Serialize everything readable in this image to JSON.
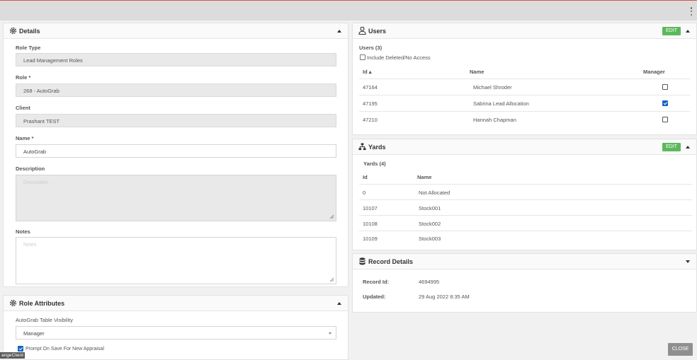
{
  "details": {
    "title": "Details",
    "role_type_label": "Role Type",
    "role_type_value": "Lead Management Roles",
    "role_label": "Role *",
    "role_value": "268 - AutoGrab",
    "client_label": "Client",
    "client_value": "Prashant TEST",
    "name_label": "Name *",
    "name_value": "AutoGrab",
    "description_label": "Description",
    "description_placeholder": "Description",
    "notes_label": "Notes",
    "notes_placeholder": "Notes"
  },
  "role_attributes": {
    "title": "Role Attributes",
    "visibility_label": "AutoGrab Table Visibility",
    "visibility_value": "Manager",
    "prompt_label": "Prompt On Save For New Appraisal",
    "prompt_checked": true
  },
  "users": {
    "title": "Users",
    "edit_label": "EDIT",
    "count_label": "Users (3)",
    "include_deleted_label": "Include Deleted/No Access",
    "col_id": "Id ▴",
    "col_name": "Name",
    "col_manager": "Manager",
    "rows": [
      {
        "id": "47164",
        "name": "Michael Shroder",
        "manager": false
      },
      {
        "id": "47195",
        "name": "Sabrina Lead Allocation",
        "manager": true
      },
      {
        "id": "47210",
        "name": "Hannah Chapman",
        "manager": false
      }
    ]
  },
  "yards": {
    "title": "Yards",
    "edit_label": "EDIT",
    "count_label": "Yards (4)",
    "col_id": "Id",
    "col_name": "Name",
    "rows": [
      {
        "id": "0",
        "name": "Not Allocated"
      },
      {
        "id": "10107",
        "name": "Stock001"
      },
      {
        "id": "10108",
        "name": "Stock002"
      },
      {
        "id": "10109",
        "name": "Stock003"
      }
    ]
  },
  "record": {
    "title": "Record Details",
    "record_id_label": "Record Id:",
    "record_id_value": "4694995",
    "updated_label": "Updated:",
    "updated_value": "29 Aug 2022 8:35 AM"
  },
  "close_label": "CLOSE",
  "footer_label": "angeClient"
}
